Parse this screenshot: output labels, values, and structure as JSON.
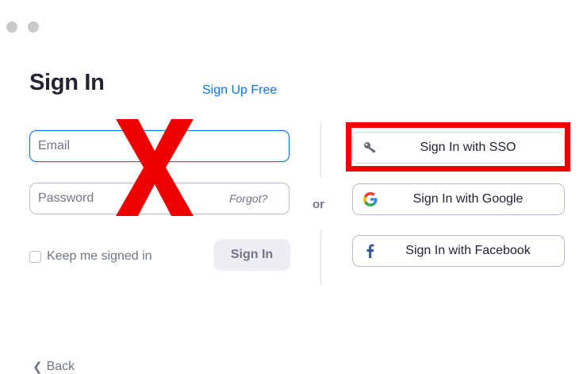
{
  "window": {
    "dots": [
      "#c9c9cc",
      "#c9c9cc"
    ]
  },
  "signin": {
    "title": "Sign In",
    "signup_link": "Sign Up Free",
    "email_placeholder": "Email",
    "password_placeholder": "Password",
    "forgot_link": "Forgot?",
    "keep_signed_in": "Keep me signed in",
    "keep_signed_in_checked": false,
    "signin_button": "Sign In"
  },
  "divider": {
    "or_label": "or"
  },
  "sso": {
    "buttons": [
      {
        "label": "Sign In with SSO",
        "icon": "key-icon"
      },
      {
        "label": "Sign In with Google",
        "icon": "google-icon"
      },
      {
        "label": "Sign In with Facebook",
        "icon": "facebook-icon"
      }
    ]
  },
  "annotations": {
    "x_mark": "X",
    "x_color": "#ee0000",
    "highlight_color": "#ee0000",
    "highlighted_item": "Sign In with SSO"
  },
  "footer": {
    "back_label": "Back"
  },
  "colors": {
    "accent": "#0e72ed",
    "text": "#232333",
    "muted": "#747487"
  }
}
